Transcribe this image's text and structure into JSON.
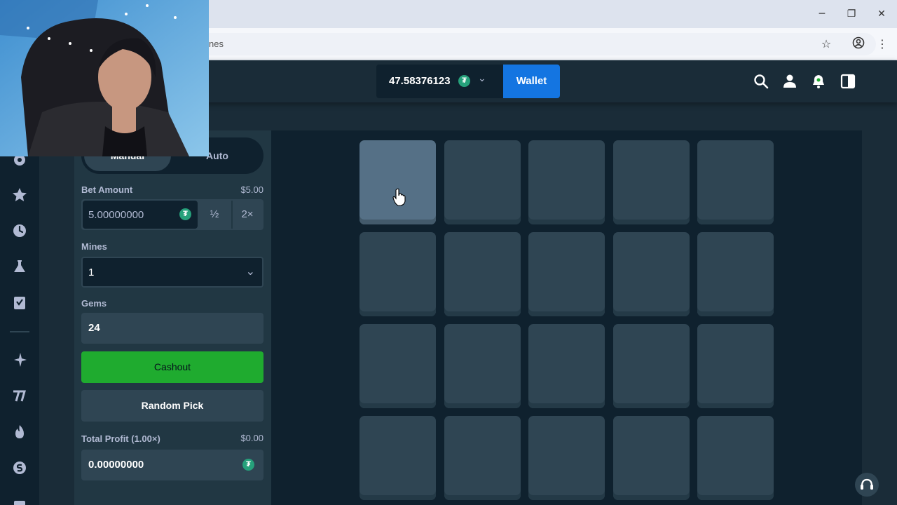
{
  "browser": {
    "url_partial": "nes",
    "window_controls": [
      "minimize-icon",
      "restore-icon",
      "close-icon"
    ],
    "addr_icons": [
      "star-icon",
      "profile-icon",
      "kebab-menu-icon"
    ]
  },
  "header": {
    "balance": "47.58376123",
    "currency_icon": "tether-icon",
    "wallet_label": "Wallet",
    "icons": [
      "search-icon",
      "user-icon",
      "bell-icon",
      "sidebar-toggle-icon"
    ]
  },
  "sidebar": {
    "icons": [
      "casino-icon",
      "star-icon",
      "clock-icon",
      "flask-icon",
      "bookmark-icon",
      "sparkle-icon",
      "slots-icon",
      "fire-icon",
      "stake-logo-icon",
      "gift-icon"
    ]
  },
  "bet_panel": {
    "tabs": [
      "Manual",
      "Auto"
    ],
    "active_tab": "Manual",
    "bet_amount_label": "Bet Amount",
    "bet_amount_usd": "$5.00",
    "bet_amount_value": "5.00000000",
    "half_label": "½",
    "double_label": "2×",
    "mines_label": "Mines",
    "mines_value": "1",
    "gems_label": "Gems",
    "gems_value": "24",
    "cashout_label": "Cashout",
    "random_pick_label": "Random Pick",
    "total_profit_label": "Total Profit (1.00×)",
    "total_profit_usd": "$0.00",
    "total_profit_value": "0.00000000"
  },
  "game": {
    "rows": 4,
    "cols": 5,
    "hovered_tile": 0,
    "colors": {
      "tile": "#2f4553",
      "tile_hover": "#557086",
      "cashout": "#1fab2f",
      "wallet": "#1475e1"
    }
  }
}
